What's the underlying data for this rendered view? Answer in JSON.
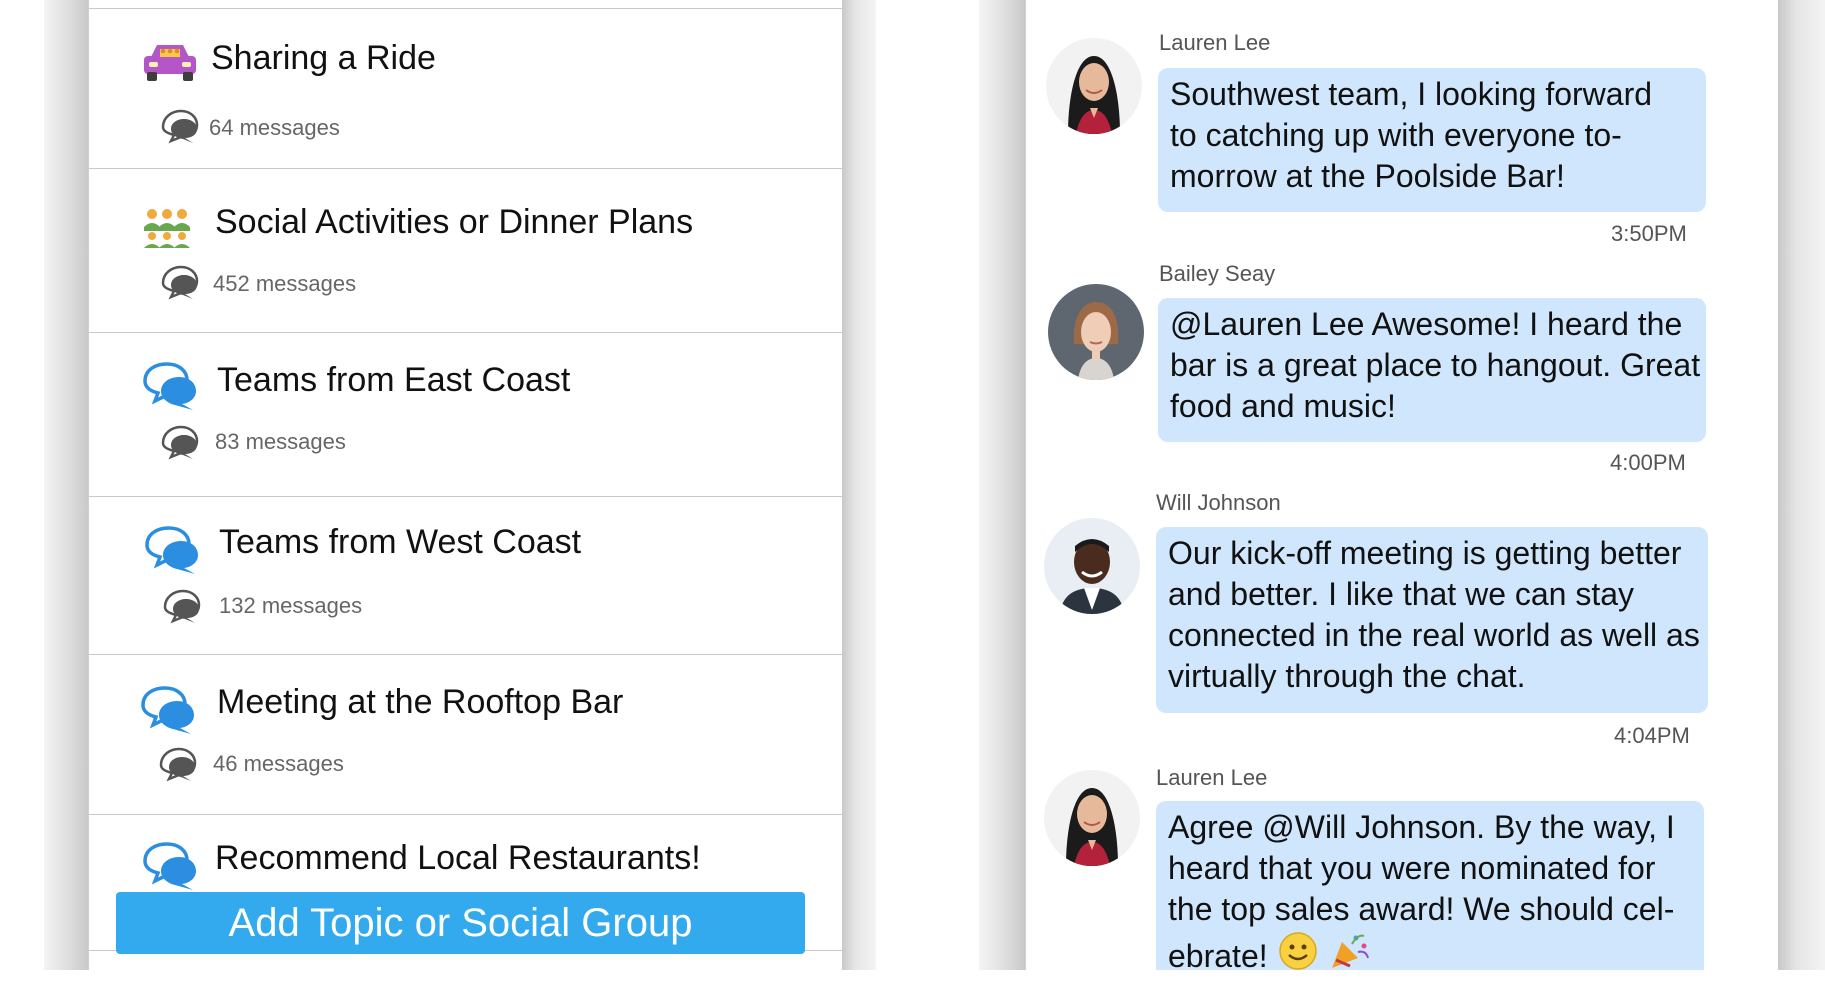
{
  "topics": {
    "items": [
      {
        "title": "Sharing a Ride",
        "count": "64 messages",
        "icon": "car-icon"
      },
      {
        "title": "Social Activities or Dinner Plans",
        "count": "452 messages",
        "icon": "group-icon"
      },
      {
        "title": "Teams from East Coast",
        "count": "83 messages",
        "icon": "chat-bubbles-icon"
      },
      {
        "title": "Teams from West Coast",
        "count": "132 messages",
        "icon": "chat-bubbles-icon"
      },
      {
        "title": "Meeting at the Rooftop Bar",
        "count": "46 messages",
        "icon": "chat-bubbles-icon"
      },
      {
        "title": "Recommend Local Restaurants!",
        "count": "",
        "icon": "chat-bubbles-icon"
      }
    ],
    "add_button_label": "Add Topic or Social Group"
  },
  "chat": {
    "messages": [
      {
        "sender": "Lauren Lee",
        "lines": [
          "Southwest team, I looking forward",
          "to catching up with everyone to-",
          "morrow at the Poolside Bar!"
        ],
        "time": "3:50PM",
        "avatar": "woman-avatar"
      },
      {
        "sender": "Bailey Seay",
        "lines": [
          "@Lauren Lee Awesome! I heard the",
          "bar is a great place to hangout. Great",
          "food and music!"
        ],
        "time": "4:00PM",
        "avatar": "woman-avatar"
      },
      {
        "sender": "Will Johnson",
        "lines": [
          "Our kick-off meeting is getting better",
          "and better. I like that we can stay",
          "connected in the real world as well as",
          "virtually through the chat."
        ],
        "time": "4:04PM",
        "avatar": "man-avatar"
      },
      {
        "sender": "Lauren Lee",
        "lines": [
          "Agree @Will Johnson.  By the way, I",
          "heard that you were nominated for",
          "the top sales award!  We should cel-",
          "ebrate!"
        ],
        "time": "",
        "avatar": "woman-avatar",
        "emoji": [
          "smiley-face-emoji",
          "party-popper-emoji"
        ]
      }
    ]
  },
  "colors": {
    "accent": "#33aaee",
    "bubble": "#cfe6fc",
    "chat_icon": "#2b8ee0",
    "car": "#b456c8"
  }
}
